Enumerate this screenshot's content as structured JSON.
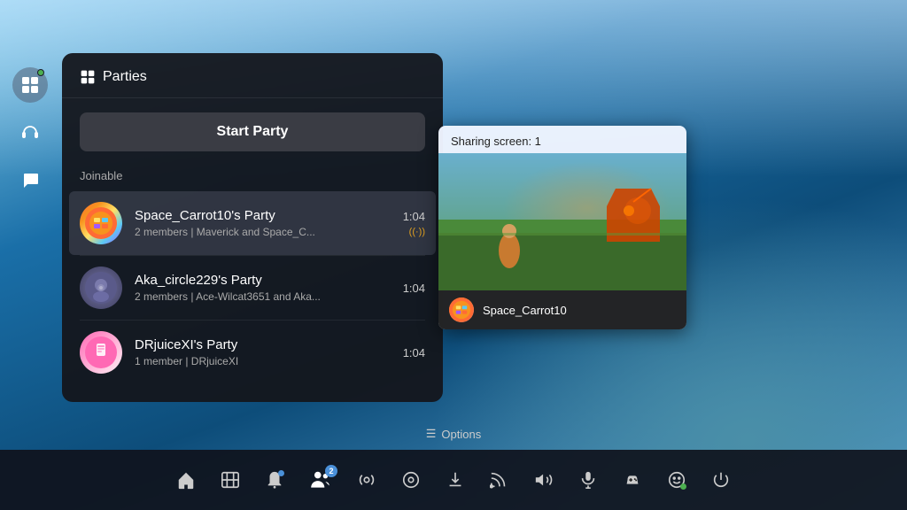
{
  "background": {
    "color_top": "#87ceeb",
    "color_mid": "#1a6fa8",
    "color_bot": "#0d4d7a"
  },
  "panel": {
    "title": "Parties",
    "start_party_label": "Start Party",
    "joinable_label": "Joinable",
    "parties": [
      {
        "id": "space-carrot",
        "name": "Space_Carrot10's Party",
        "members": "2 members | Maverick and Space_C...",
        "time": "1:04",
        "streaming": true,
        "streaming_icon": "((·))",
        "avatar_emoji": "🎮"
      },
      {
        "id": "aka-circle",
        "name": "Aka_circle229's Party",
        "members": "2 members | Ace-Wilcat3651 and Aka...",
        "time": "1:04",
        "streaming": false,
        "avatar_emoji": "🌀"
      },
      {
        "id": "drjuice",
        "name": "DRjuiceXI's Party",
        "members": "1 member | DRjuiceXI",
        "time": "1:04",
        "streaming": false,
        "avatar_emoji": "📱"
      }
    ]
  },
  "share_popup": {
    "header": "Sharing screen: 1",
    "player_name": "Space_Carrot10"
  },
  "sidebar": {
    "icons": [
      {
        "id": "parties",
        "symbol": "⊞",
        "active": true,
        "has_dot": true
      },
      {
        "id": "headset",
        "symbol": "🎧",
        "active": false,
        "has_dot": false
      },
      {
        "id": "chat",
        "symbol": "💬",
        "active": false,
        "has_dot": false
      }
    ]
  },
  "taskbar": {
    "icons": [
      {
        "id": "home",
        "symbol": "⌂",
        "label": "home"
      },
      {
        "id": "store",
        "symbol": "🛍",
        "label": "store"
      },
      {
        "id": "bell",
        "symbol": "🔔",
        "label": "notifications",
        "badge": ""
      },
      {
        "id": "friends",
        "symbol": "👥",
        "label": "friends",
        "badge": "2",
        "active": true
      },
      {
        "id": "radio",
        "symbol": "📡",
        "label": "radio"
      },
      {
        "id": "disc",
        "symbol": "⊙",
        "label": "disc"
      },
      {
        "id": "download",
        "symbol": "⬇",
        "label": "download"
      },
      {
        "id": "cast",
        "symbol": "📶",
        "label": "cast"
      },
      {
        "id": "volume",
        "symbol": "🔊",
        "label": "volume"
      },
      {
        "id": "mic",
        "symbol": "🎤",
        "label": "mic"
      },
      {
        "id": "controller",
        "symbol": "🎮",
        "label": "controller"
      },
      {
        "id": "face",
        "symbol": "😊",
        "label": "face",
        "has_dot": true
      },
      {
        "id": "power",
        "symbol": "⏻",
        "label": "power"
      }
    ],
    "options_label": "Options",
    "options_icon": "☰"
  }
}
